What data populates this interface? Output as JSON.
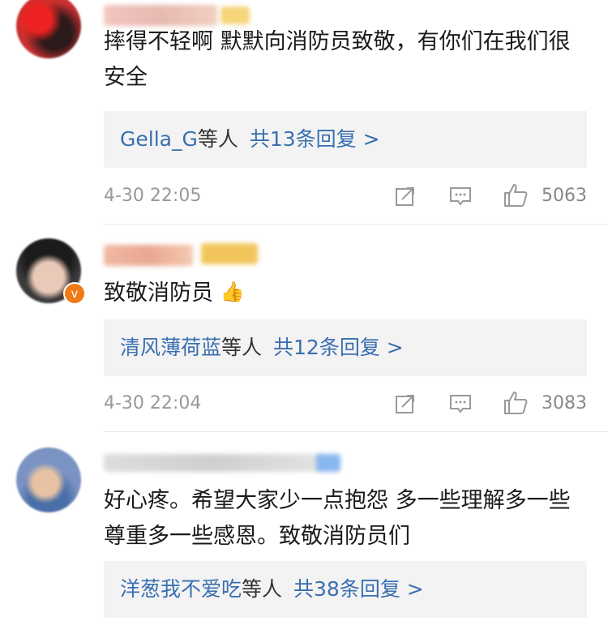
{
  "comments": [
    {
      "text": "摔得不轻啊 默默向消防员致敬，有你们在我们很安全",
      "reply_names": "Gella_G",
      "reply_etc": "等人",
      "reply_count": "共13条回复 >",
      "time": "4-30 22:05",
      "likes": "5063"
    },
    {
      "text": "致敬消防员",
      "emoji": "👍",
      "reply_names": "清风薄荷蓝",
      "reply_etc": "等人",
      "reply_count": "共12条回复 >",
      "time": "4-30 22:04",
      "likes": "3083"
    },
    {
      "text": "好心疼。希望大家少一点抱怨 多一些理解多一些尊重多一些感恩。致敬消防员们",
      "reply_names": "洋葱我不爱吃",
      "reply_etc": "等人",
      "reply_count": "共38条回复 >"
    }
  ],
  "icons": {
    "share": "share-icon",
    "comment": "comment-icon",
    "like": "thumbs-up-icon",
    "verified": "verified-badge-icon"
  },
  "colors": {
    "link": "#3a6fb0",
    "reply_bg": "#f3f3f3",
    "meta": "#999999",
    "verified": "#f07a15"
  }
}
